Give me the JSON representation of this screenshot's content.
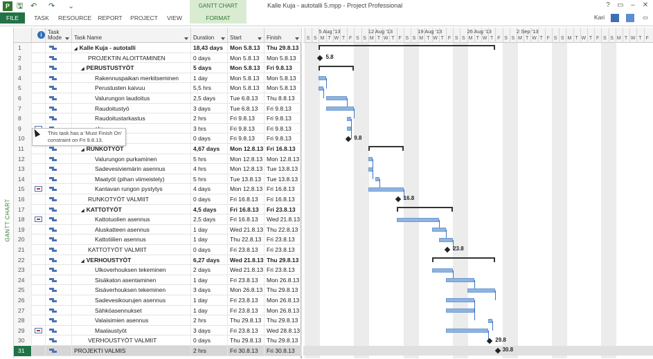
{
  "window": {
    "title": "Kalle Kuja - autotalli 5.mpp - Project Professional",
    "tools_context": "GANTT CHART TOOLS",
    "user": "Kari",
    "help": "?"
  },
  "ribbon": {
    "tabs": [
      "FILE",
      "TASK",
      "RESOURCE",
      "REPORT",
      "PROJECT",
      "VIEW",
      "FORMAT"
    ]
  },
  "view_label": "GANTT CHART",
  "table": {
    "headers": {
      "mode_line1": "Task",
      "mode_line2": "Mode",
      "name": "Task Name",
      "duration": "Duration",
      "start": "Start",
      "finish": "Finish"
    },
    "rows": [
      {
        "id": "1",
        "name": "Kalle Kuja - autotalli",
        "duration": "18,43 days",
        "start": "Mon 5.8.13",
        "finish": "Thu 29.8.13",
        "summary": true,
        "level": 0,
        "collapse": "◢"
      },
      {
        "id": "2",
        "name": "PROJEKTIN ALOITTAMINEN",
        "duration": "0 days",
        "start": "Mon 5.8.13",
        "finish": "Mon 5.8.13",
        "summary": false,
        "level": 1
      },
      {
        "id": "3",
        "name": "PERUSTUSTYÖT",
        "duration": "5 days",
        "start": "Mon 5.8.13",
        "finish": "Fri 9.8.13",
        "summary": true,
        "level": 1,
        "collapse": "◢"
      },
      {
        "id": "4",
        "name": "Rakennuspaikan merkitseminen",
        "duration": "1 day",
        "start": "Mon 5.8.13",
        "finish": "Mon 5.8.13",
        "summary": false,
        "level": 2
      },
      {
        "id": "5",
        "name": "Perustusten kaivuu",
        "duration": "5,5 hrs",
        "start": "Mon 5.8.13",
        "finish": "Mon 5.8.13",
        "summary": false,
        "level": 2
      },
      {
        "id": "6",
        "name": "Valurungon laudoitus",
        "duration": "2,5 days",
        "start": "Tue 6.8.13",
        "finish": "Thu 8.8.13",
        "summary": false,
        "level": 2
      },
      {
        "id": "7",
        "name": "Raudoitustyö",
        "duration": "3 days",
        "start": "Tue 6.8.13",
        "finish": "Fri 9.8.13",
        "summary": false,
        "level": 2
      },
      {
        "id": "8",
        "name": "Raudoitustarkastus",
        "duration": "2 hrs",
        "start": "Fri 9.8.13",
        "finish": "Fri 9.8.13",
        "summary": false,
        "level": 2
      },
      {
        "id": "9",
        "name": "alu",
        "duration": "3 hrs",
        "start": "Fri 9.8.13",
        "finish": "Fri 9.8.13",
        "summary": false,
        "level": 2,
        "indicator": true
      },
      {
        "id": "10",
        "name": "VALMIIT",
        "duration": "0 days",
        "start": "Fri 9.8.13",
        "finish": "Fri 9.8.13",
        "summary": false,
        "level": 2
      },
      {
        "id": "11",
        "name": "RUNKOTYÖT",
        "duration": "4,67 days",
        "start": "Mon 12.8.13",
        "finish": "Fri 16.8.13",
        "summary": true,
        "level": 1,
        "collapse": "◢"
      },
      {
        "id": "12",
        "name": "Valurungon purkaminen",
        "duration": "5 hrs",
        "start": "Mon 12.8.13",
        "finish": "Mon 12.8.13",
        "summary": false,
        "level": 2
      },
      {
        "id": "13",
        "name": "Sadevesiviemärin asennus",
        "duration": "4 hrs",
        "start": "Mon 12.8.13",
        "finish": "Tue 13.8.13",
        "summary": false,
        "level": 2
      },
      {
        "id": "14",
        "name": "Maatyöt (pihan viimeistely)",
        "duration": "5 hrs",
        "start": "Tue 13.8.13",
        "finish": "Tue 13.8.13",
        "summary": false,
        "level": 2
      },
      {
        "id": "15",
        "name": "Kantavan rungon pystytys",
        "duration": "4 days",
        "start": "Mon 12.8.13",
        "finish": "Fri 16.8.13",
        "summary": false,
        "level": 2,
        "indicator": true
      },
      {
        "id": "16",
        "name": "RUNKOTYÖT VALMIIT",
        "duration": "0 days",
        "start": "Fri 16.8.13",
        "finish": "Fri 16.8.13",
        "summary": false,
        "level": 1
      },
      {
        "id": "17",
        "name": "KATTOTYÖT",
        "duration": "4,5 days",
        "start": "Fri 16.8.13",
        "finish": "Fri 23.8.13",
        "summary": true,
        "level": 1,
        "collapse": "◢"
      },
      {
        "id": "18",
        "name": "Kattotuolien asennus",
        "duration": "2,5 days",
        "start": "Fri 16.8.13",
        "finish": "Wed 21.8.13",
        "summary": false,
        "level": 2,
        "indicator": true
      },
      {
        "id": "19",
        "name": "Aluskatteen asennus",
        "duration": "1 day",
        "start": "Wed 21.8.13",
        "finish": "Thu 22.8.13",
        "summary": false,
        "level": 2
      },
      {
        "id": "20",
        "name": "Kattotiilien asennus",
        "duration": "1 day",
        "start": "Thu 22.8.13",
        "finish": "Fri 23.8.13",
        "summary": false,
        "level": 2
      },
      {
        "id": "21",
        "name": "KATTOTYÖT VALMIIT",
        "duration": "0 days",
        "start": "Fri 23.8.13",
        "finish": "Fri 23.8.13",
        "summary": false,
        "level": 1
      },
      {
        "id": "22",
        "name": "VERHOUSTYÖT",
        "duration": "6,27 days",
        "start": "Wed 21.8.13",
        "finish": "Thu 29.8.13",
        "summary": true,
        "level": 1,
        "collapse": "◢"
      },
      {
        "id": "23",
        "name": "Ulkoverhouksen tekeminen",
        "duration": "2 days",
        "start": "Wed 21.8.13",
        "finish": "Fri 23.8.13",
        "summary": false,
        "level": 2
      },
      {
        "id": "24",
        "name": "Sisäkaton asentaminen",
        "duration": "1 day",
        "start": "Fri 23.8.13",
        "finish": "Mon 26.8.13",
        "summary": false,
        "level": 2
      },
      {
        "id": "25",
        "name": "Sisäverhouksen tekeminen",
        "duration": "3 days",
        "start": "Mon 26.8.13",
        "finish": "Thu 29.8.13",
        "summary": false,
        "level": 2
      },
      {
        "id": "26",
        "name": "Sadevesikourujen asennus",
        "duration": "1 day",
        "start": "Fri 23.8.13",
        "finish": "Mon 26.8.13",
        "summary": false,
        "level": 2
      },
      {
        "id": "27",
        "name": "Sähköasennukset",
        "duration": "1 day",
        "start": "Fri 23.8.13",
        "finish": "Mon 26.8.13",
        "summary": false,
        "level": 2
      },
      {
        "id": "28",
        "name": "Valaisimien asennus",
        "duration": "2 hrs",
        "start": "Thu 29.8.13",
        "finish": "Thu 29.8.13",
        "summary": false,
        "level": 2
      },
      {
        "id": "29",
        "name": "Maalaustyöt",
        "duration": "3 days",
        "start": "Fri 23.8.13",
        "finish": "Wed 28.8.13",
        "summary": false,
        "level": 2,
        "indicator": true
      },
      {
        "id": "30",
        "name": "VERHOUSTYÖT VALMIIT",
        "duration": "0 days",
        "start": "Thu 29.8.13",
        "finish": "Thu 29.8.13",
        "summary": false,
        "level": 1
      },
      {
        "id": "31",
        "name": "PROJEKTI VALMIS",
        "duration": "2 hrs",
        "start": "Fri 30.8.13",
        "finish": "Fri 30.8.13",
        "summary": false,
        "level": 0,
        "selected": true
      }
    ]
  },
  "tooltip": {
    "text": "This task has a 'Must Finish On' constraint on Fri 9.8.13."
  },
  "timescale": {
    "weeks": [
      "5 Aug '13",
      "12 Aug '13",
      "19 Aug '13",
      "26 Aug '13",
      "2 Sep '13"
    ],
    "days": [
      "S",
      "S",
      "M",
      "T",
      "W",
      "T",
      "F"
    ]
  },
  "milestone_labels": {
    "m2": "5.8",
    "m10": "9.8",
    "m16": "16.8",
    "m21": "23.8",
    "m30": "29.8",
    "m31": "30.8"
  },
  "colors": {
    "accent": "#217346",
    "task_bar": "#8fb4e0",
    "link": "#3d74c2"
  }
}
